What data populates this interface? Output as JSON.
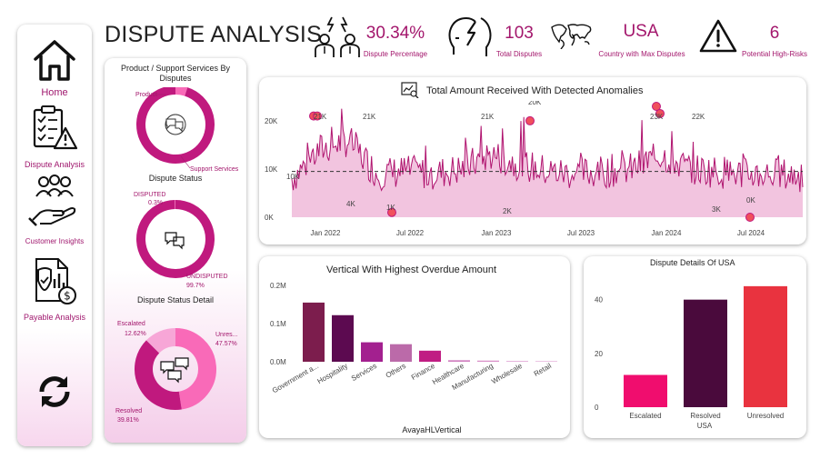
{
  "title": "DISPUTE ANALYSIS",
  "nav": [
    {
      "label": "Home",
      "icon": "home-icon"
    },
    {
      "label": "Dispute Analysis",
      "icon": "clipboard-warning-icon"
    },
    {
      "label": "Customer Insights",
      "icon": "customers-hand-icon"
    },
    {
      "label": "Payable Analysis",
      "icon": "payable-document-icon"
    }
  ],
  "refresh_icon": "refresh-icon",
  "kpis": [
    {
      "value": "30.34%",
      "label": "Dispute Percentage",
      "icon": "people-dispute-icon"
    },
    {
      "value": "103",
      "label": "Total Disputes",
      "icon": "heads-conflict-icon"
    },
    {
      "value": "USA",
      "label": "Country with Max Disputes",
      "icon": "world-map-icon"
    },
    {
      "value": "6",
      "label": "Potential High-Risks",
      "icon": "warning-icon"
    }
  ],
  "colors": {
    "accent": "#a3166c",
    "pink": "#f96ab8",
    "dark": "#4a0a3c",
    "red": "#e9333f",
    "hotpink": "#f00d6e"
  },
  "donut1": {
    "title": "Product / Support Services By Disputes",
    "labels": [
      "Product",
      "Support Services"
    ],
    "chart_data": {
      "type": "pie",
      "categories": [
        "Product",
        "Support Services"
      ],
      "values": [
        5,
        95
      ]
    }
  },
  "donut2": {
    "title": "Dispute Status",
    "labels": [
      "DISPUTED",
      "0.3%",
      "UNDISPUTED",
      "99.7%"
    ],
    "chart_data": {
      "type": "pie",
      "categories": [
        "DISPUTED",
        "UNDISPUTED"
      ],
      "values": [
        0.3,
        99.7
      ]
    }
  },
  "donut3": {
    "title": "Dispute Status Detail",
    "labels": [
      "Escalated",
      "12.62%",
      "Unres...",
      "47.57%",
      "Resolved",
      "39.81%"
    ],
    "chart_data": {
      "type": "pie",
      "categories": [
        "Unresolved",
        "Resolved",
        "Escalated"
      ],
      "values": [
        47.57,
        39.81,
        12.62
      ]
    }
  },
  "line": {
    "title": "Total Amount Received With Detected Anomalies",
    "icon": "anomaly-chart-icon",
    "ylabels": [
      "20K",
      "10K",
      "0K"
    ],
    "xlabels": [
      "Jan 2022",
      "Jul 2022",
      "Jan 2023",
      "Jul 2023",
      "Jan 2024",
      "Jul 2024"
    ],
    "annotations": [
      "21K",
      "21K",
      "21K",
      "20K",
      "23K",
      "22K",
      "4K",
      "1K",
      "2K",
      "3K",
      "0K",
      "10K",
      "2K"
    ],
    "chart_data": {
      "type": "line",
      "ylim": [
        0,
        23000
      ],
      "mean_line": 9500,
      "series": [
        {
          "x": [
            "2021-11",
            "2022-01",
            "2022-03",
            "2022-05",
            "2022-07",
            "2022-09",
            "2022-11",
            "2023-01",
            "2023-03",
            "2023-05",
            "2023-07",
            "2023-09",
            "2023-11",
            "2024-01",
            "2024-03",
            "2024-05",
            "2024-07",
            "2024-09",
            "2024-10"
          ],
          "y": [
            8000,
            14000,
            16000,
            9000,
            9500,
            9000,
            10000,
            13000,
            11000,
            9500,
            9000,
            9500,
            10000,
            13000,
            10000,
            9500,
            9000,
            9000,
            8500
          ]
        }
      ],
      "anomalies": [
        {
          "x": "2021-12",
          "y": 21000
        },
        {
          "x": "2022-06",
          "y": 1000
        },
        {
          "x": "2023-01",
          "y": 20000
        },
        {
          "x": "2023-12",
          "y": 23000
        }
      ]
    }
  },
  "bar1": {
    "title": "Vertical With Highest Overdue Amount",
    "xlabel": "AvayaHLVertical",
    "ylabels": [
      "0.2M",
      "0.1M",
      "0.0M"
    ],
    "chart_data": {
      "type": "bar",
      "categories": [
        "Government a...",
        "Hospitality",
        "Services",
        "Others",
        "Finance",
        "Healthcare",
        "Manufacturing",
        "Wholesale",
        "Retail"
      ],
      "values": [
        0.155,
        0.122,
        0.051,
        0.046,
        0.029,
        0.004,
        0.003,
        0.002,
        0.002
      ],
      "ylim": [
        0,
        0.2
      ],
      "colors": [
        "#7c1d4d",
        "#5c0a50",
        "#a3208f",
        "#bb6aa9",
        "#c01d83",
        "#d07fbf",
        "#d98fc8",
        "#e2a5d5",
        "#e8b9de"
      ]
    }
  },
  "bar2": {
    "title": "Dispute Details Of USA",
    "xlabel": "USA",
    "ylabels": [
      "40",
      "20",
      "0"
    ],
    "chart_data": {
      "type": "bar",
      "categories": [
        "Escalated",
        "Resolved",
        "Unresolved"
      ],
      "values": [
        12,
        40,
        45
      ],
      "ylim": [
        0,
        48
      ],
      "colors": [
        "#f00d6e",
        "#4a0a3c",
        "#e9333f"
      ]
    }
  }
}
